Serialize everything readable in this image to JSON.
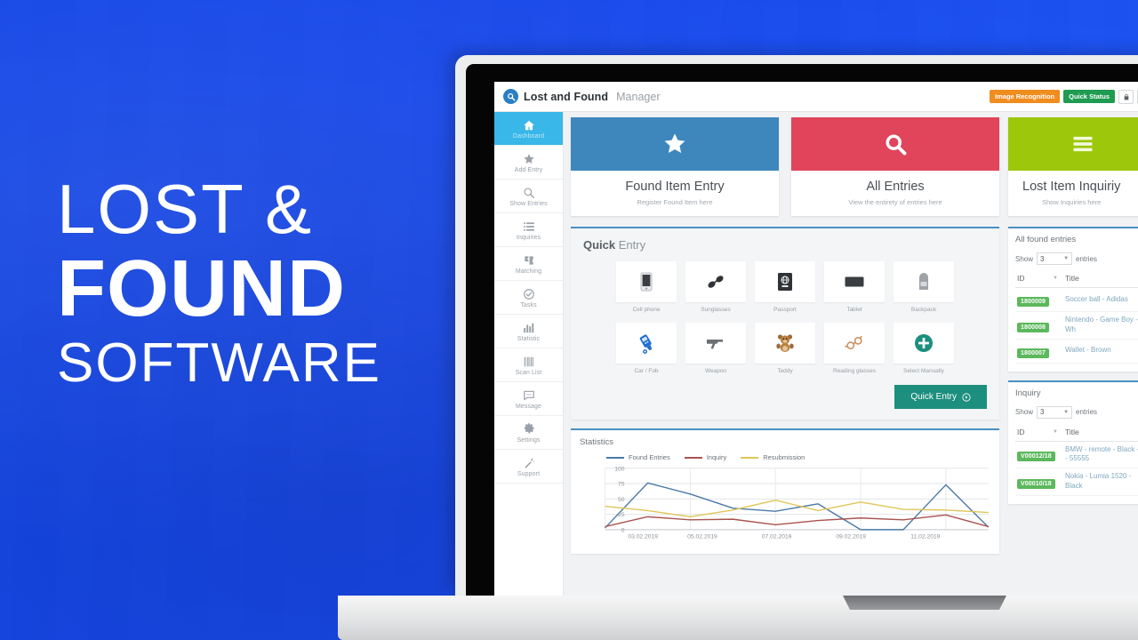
{
  "promo": {
    "line1": "LOST &",
    "line2": "FOUND",
    "line3": "SOFTWARE"
  },
  "app": {
    "brand_name": "Lost and Found",
    "brand_sub": "Manager",
    "brand_logo_icon": "magnifier-logo-icon",
    "header_buttons": [
      {
        "label": "Image Recognition",
        "color": "#ef8d1f",
        "name": "image-recognition-button"
      },
      {
        "label": "Quick Status",
        "color": "#1f9b52",
        "name": "quick-status-button"
      }
    ],
    "header_icons": [
      {
        "icon": "lock-icon",
        "name": "lock-button"
      },
      {
        "icon": "user-icon",
        "name": "account-button"
      }
    ]
  },
  "sidebar": {
    "items": [
      {
        "label": "Dashboard",
        "icon": "home-icon",
        "active": true
      },
      {
        "label": "Add Entry",
        "icon": "star-icon",
        "active": false
      },
      {
        "label": "Show Entries",
        "icon": "search-icon",
        "active": false
      },
      {
        "label": "Inquiries",
        "icon": "list-icon",
        "active": false
      },
      {
        "label": "Matching",
        "icon": "puzzle-icon",
        "active": false
      },
      {
        "label": "Tasks",
        "icon": "check-circle-icon",
        "active": false
      },
      {
        "label": "Statistic",
        "icon": "bar-chart-icon",
        "active": false
      },
      {
        "label": "Scan List",
        "icon": "barcode-icon",
        "active": false
      },
      {
        "label": "Message",
        "icon": "chat-icon",
        "active": false
      },
      {
        "label": "Settings",
        "icon": "gear-icon",
        "active": false
      },
      {
        "label": "Support",
        "icon": "wand-icon",
        "active": false
      }
    ]
  },
  "cards": [
    {
      "title": "Found Item Entry",
      "subtitle": "Register Found Item here",
      "icon": "star-icon",
      "color": "#3d87bd"
    },
    {
      "title": "All Entries",
      "subtitle": "View the entirety of entries here",
      "icon": "search-icon",
      "color": "#e0455b"
    },
    {
      "title": "Lost Item Inquiriy",
      "subtitle": "Show Inquiries here",
      "icon": "list-icon",
      "color": "#9cc70b"
    }
  ],
  "quick_entry": {
    "title_bold": "Quick",
    "title_rest": " Entry",
    "button_label": "Quick Entry",
    "button_icon": "arrow-right-circle-icon",
    "tiles_row1": [
      {
        "label": "Cell phone",
        "icon": "cellphone-icon"
      },
      {
        "label": "Sunglasses",
        "icon": "sunglasses-icon"
      },
      {
        "label": "Passport",
        "icon": "passport-icon"
      },
      {
        "label": "Tablet",
        "icon": "tablet-icon"
      },
      {
        "label": "Backpack",
        "icon": "backpack-icon"
      }
    ],
    "tiles_row2": [
      {
        "label": "Car / Fob",
        "icon": "car-key-icon"
      },
      {
        "label": "Weapon",
        "icon": "weapon-icon"
      },
      {
        "label": "Teddy",
        "icon": "teddy-icon"
      },
      {
        "label": "Reading glasses",
        "icon": "reading-glasses-icon"
      },
      {
        "label": "Select Manually",
        "icon": "plus-circle-icon"
      }
    ]
  },
  "statistics": {
    "title": "Statistics"
  },
  "chart_data": {
    "type": "line",
    "title": "Statistics",
    "xlabel": "",
    "ylabel": "",
    "ylim": [
      0,
      100
    ],
    "yticks": [
      0,
      25,
      50,
      75,
      100
    ],
    "grid": true,
    "legend_position": "top-left",
    "x": [
      "03.02.2019",
      "04.02.2019",
      "05.02.2019",
      "06.02.2019",
      "07.02.2019",
      "08.02.2019",
      "09.02.2019",
      "10.02.2019",
      "11.02.2019",
      "12.02.2019"
    ],
    "xtick_labels": [
      "03.02.2019",
      "05.02.2019",
      "07.02.2019",
      "09.02.2019",
      "11.02.2019"
    ],
    "series": [
      {
        "name": "Found Entries",
        "color": "#4a7aa7",
        "values": [
          3,
          76,
          58,
          35,
          30,
          42,
          0,
          0,
          73,
          4
        ]
      },
      {
        "name": "Inquiry",
        "color": "#a9534f",
        "values": [
          5,
          21,
          16,
          17,
          8,
          15,
          19,
          16,
          24,
          5
        ]
      },
      {
        "name": "Resubmission",
        "color": "#e0c558",
        "values": [
          38,
          31,
          21,
          32,
          48,
          31,
          45,
          33,
          32,
          28
        ]
      }
    ]
  },
  "found_panel": {
    "title": "All found entries",
    "show_label": "Show",
    "show_value": "3",
    "entries_label": "entries",
    "columns": [
      "ID",
      "Title"
    ],
    "rows": [
      {
        "id": "1800009",
        "title": "Soccer ball - Adidas"
      },
      {
        "id": "1800008",
        "title": "Nintendo - Game Boy - Wh"
      },
      {
        "id": "1800007",
        "title": "Wallet - Brown"
      }
    ]
  },
  "inquiry_panel": {
    "title": "Inquiry",
    "show_label": "Show",
    "show_value": "3",
    "entries_label": "entries",
    "columns": [
      "ID",
      "Title"
    ],
    "rows": [
      {
        "id": "V00012/18",
        "title": "BMW - remote - Black - 1 - 55555"
      },
      {
        "id": "V00010/18",
        "title": "Nokia - Lumia 1520 - Black"
      }
    ]
  },
  "colors": {
    "promo_bg": "#1b4fe6",
    "accent_blue": "#4a90c2",
    "sidebar_active": "#38b7e8",
    "teal_button": "#1d8f7e",
    "badge_green": "#5cb85c"
  }
}
